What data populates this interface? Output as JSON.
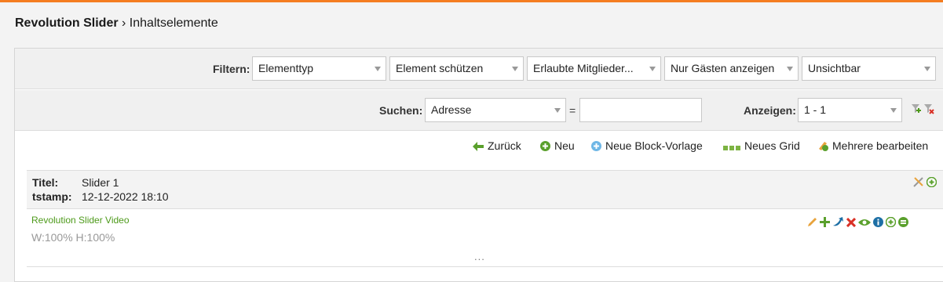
{
  "title": {
    "main": "Revolution Slider",
    "separator": " › ",
    "sub": "Inhaltselemente"
  },
  "filters": {
    "label": "Filtern:",
    "selects": [
      "Elementtyp",
      "Element schützen",
      "Erlaubte Mitglieder...",
      "Nur Gästen anzeigen",
      "Unsichtbar"
    ]
  },
  "search": {
    "label": "Suchen:",
    "field": "Adresse",
    "operator": "=",
    "value": "",
    "show_label": "Anzeigen:",
    "show_value": "1 - 1"
  },
  "toolbar": {
    "back": "Zurück",
    "new": "Neu",
    "new_block_template": "Neue Block-Vorlage",
    "new_grid": "Neues Grid",
    "edit_multiple": "Mehrere bearbeiten"
  },
  "record": {
    "title_key": "Titel:",
    "title_value": "Slider 1",
    "tstamp_key": "tstamp:",
    "tstamp_value": "12-12-2022 18:10"
  },
  "element": {
    "type_label": "Revolution Slider Video",
    "dimensions": "W:100% H:100%",
    "more": "..."
  },
  "colors": {
    "accent": "#f47c20",
    "green": "#4d9a1a",
    "blue": "#1d6fa5",
    "red": "#d93025"
  }
}
